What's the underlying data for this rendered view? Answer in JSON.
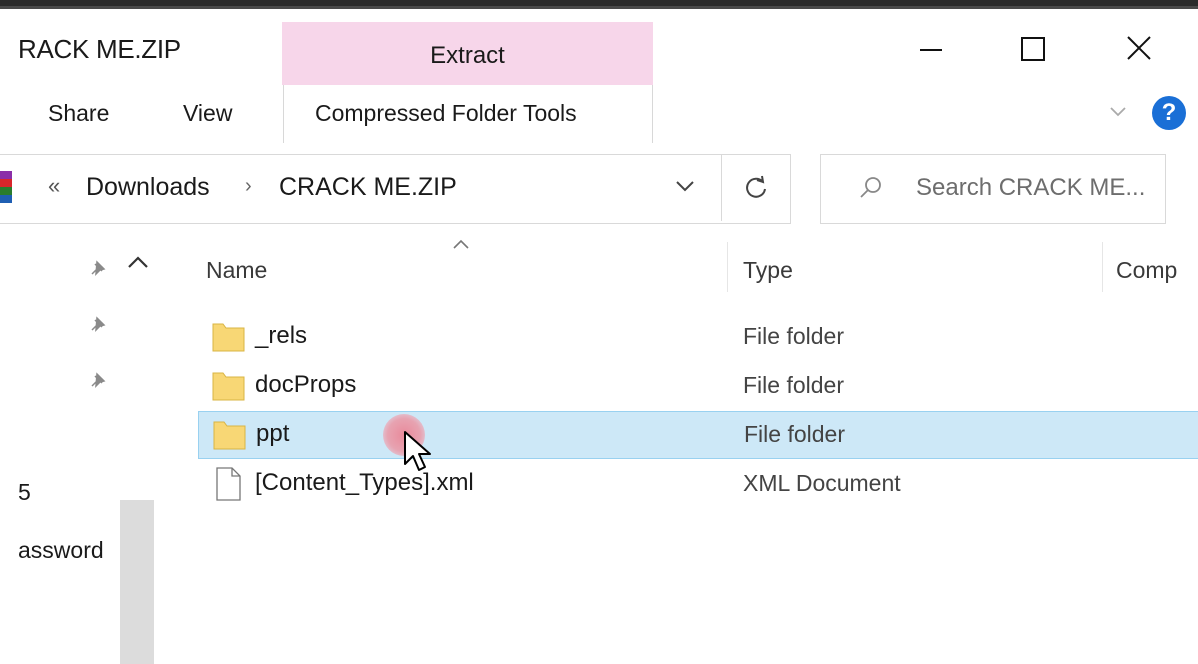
{
  "window": {
    "title": "RACK ME.ZIP",
    "contextual_tab": "Extract",
    "controls": {
      "minimize_icon": "minimize-icon",
      "maximize_icon": "maximize-icon",
      "close_icon": "close-icon"
    }
  },
  "ribbon": {
    "tabs": [
      {
        "label": "Share"
      },
      {
        "label": "View"
      },
      {
        "label": "Compressed Folder Tools"
      }
    ],
    "help": "?"
  },
  "address": {
    "chevrons": "«",
    "crumbs": [
      "Downloads",
      "CRACK ME.ZIP"
    ],
    "separator": "›"
  },
  "search": {
    "placeholder": "Search CRACK ME..."
  },
  "nav_pane": {
    "partial_items": [
      "5",
      "assword"
    ]
  },
  "columns": {
    "name": "Name",
    "type": "Type",
    "compressed": "Comp"
  },
  "files": [
    {
      "name": "_rels",
      "type": "File folder",
      "kind": "folder",
      "selected": false
    },
    {
      "name": "docProps",
      "type": "File folder",
      "kind": "folder",
      "selected": false
    },
    {
      "name": "ppt",
      "type": "File folder",
      "kind": "folder",
      "selected": true
    },
    {
      "name": "[Content_Types].xml",
      "type": "XML Document",
      "kind": "file",
      "selected": false
    }
  ],
  "colors": {
    "extract_tab": "#f7d6ea",
    "selection": "#cde8f7",
    "selection_border": "#99d1f0",
    "help": "#1a6fd6",
    "folder": "#f8d775"
  }
}
